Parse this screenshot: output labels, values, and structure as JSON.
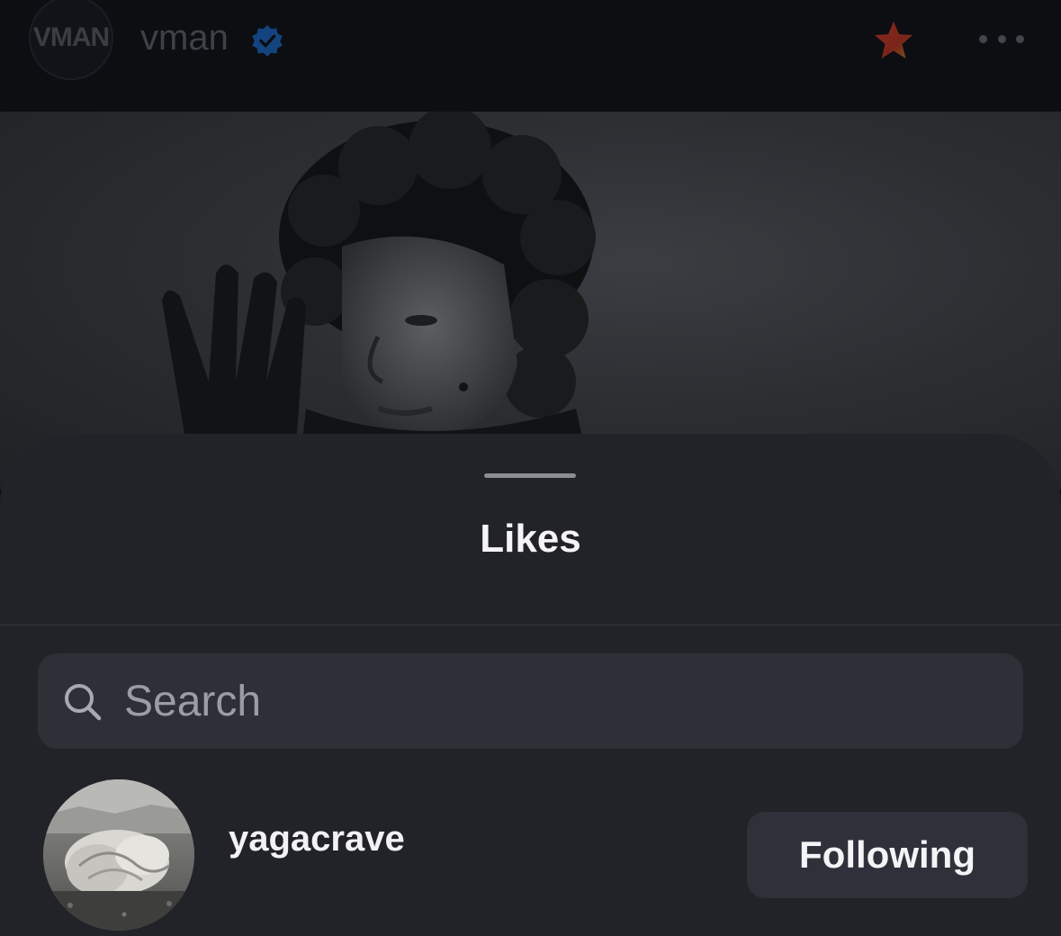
{
  "header": {
    "brand_logo_text": "VMAN",
    "account_name": "vman",
    "verified_color": "#1d6fd6",
    "star_color": "#e0452b"
  },
  "sheet": {
    "title": "Likes",
    "search": {
      "placeholder": "Search",
      "value": ""
    },
    "users": [
      {
        "username": "yagacrave",
        "button_label": "Following"
      }
    ]
  },
  "colors": {
    "background": "#0d0f13",
    "sheet": "#212329",
    "search_field": "#2d3037",
    "button": "#2e3139",
    "text": "#f4f4f6"
  }
}
